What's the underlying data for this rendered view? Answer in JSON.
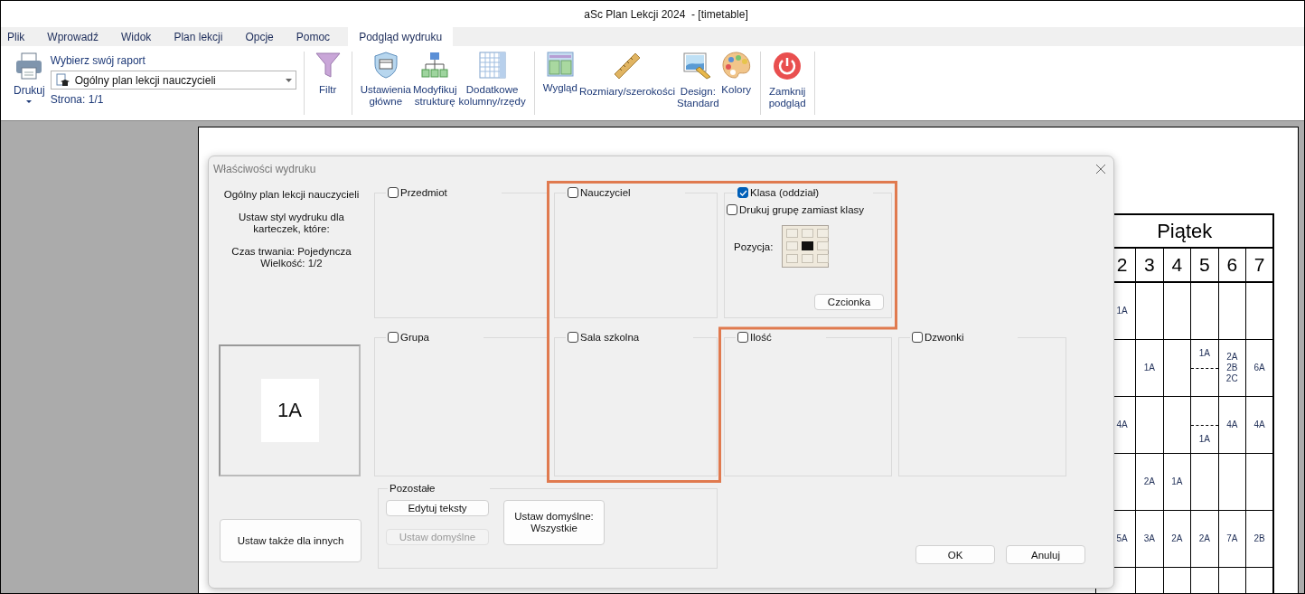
{
  "window": {
    "title": "aSc Plan Lekcji 2024  - [timetable]"
  },
  "menu_tabs": [
    {
      "label": "Plik",
      "selected": false
    },
    {
      "label": "Wprowadź",
      "selected": false
    },
    {
      "label": "Widok",
      "selected": false
    },
    {
      "label": "Plan lekcji",
      "selected": false
    },
    {
      "label": "Opcje",
      "selected": false
    },
    {
      "label": "Pomoc",
      "selected": false
    },
    {
      "label": "Podgląd wydruku",
      "selected": true
    }
  ],
  "ribbon": {
    "print_button": "Drukuj",
    "report_label": "Wybierz swój raport",
    "report_select": {
      "value": "Ogólny plan lekcji nauczycieli"
    },
    "page_info": "Strona: 1/1",
    "groups": [
      [
        {
          "kind": "filter",
          "label": "Filtr"
        }
      ],
      [
        {
          "kind": "settings",
          "label": "Ustawienia\ngłówne"
        },
        {
          "kind": "structure",
          "label": "Modyfikuj\nstrukturę"
        },
        {
          "kind": "columns",
          "label": "Dodatkowe\nkolumny/rzędy"
        }
      ],
      [
        {
          "kind": "layout",
          "label": "Wygląd"
        },
        {
          "kind": "sizes",
          "label": "Rozmiary/szerokości"
        },
        {
          "kind": "design",
          "label": "Design:\nStandard"
        },
        {
          "kind": "colors",
          "label": "Kolory"
        }
      ],
      [
        {
          "kind": "close",
          "label": "Zamknij\npodgląd"
        }
      ]
    ]
  },
  "timetable": {
    "day": "Piątek",
    "periods": [
      "2",
      "3",
      "4",
      "5",
      "6",
      "7"
    ],
    "rows": [
      [
        {
          "kind": "plain",
          "lines": [
            "1A"
          ]
        },
        {
          "kind": "empty"
        },
        {
          "kind": "empty"
        },
        {
          "kind": "empty"
        },
        {
          "kind": "empty"
        },
        {
          "kind": "empty"
        }
      ],
      [
        {
          "kind": "empty"
        },
        {
          "kind": "plain",
          "lines": [
            "1A"
          ]
        },
        {
          "kind": "empty"
        },
        {
          "kind": "split",
          "upper": "1A"
        },
        {
          "kind": "plain",
          "lines": [
            "2A",
            "2B",
            "2C"
          ]
        },
        {
          "kind": "plain",
          "lines": [
            "6A"
          ]
        }
      ],
      [
        {
          "kind": "plain",
          "lines": [
            "4A"
          ]
        },
        {
          "kind": "empty"
        },
        {
          "kind": "empty"
        },
        {
          "kind": "split",
          "lower": "1A"
        },
        {
          "kind": "plain",
          "lines": [
            "4A"
          ]
        },
        {
          "kind": "plain",
          "lines": [
            "4A"
          ]
        }
      ],
      [
        {
          "kind": "empty"
        },
        {
          "kind": "plain",
          "lines": [
            "2A"
          ]
        },
        {
          "kind": "plain",
          "lines": [
            "1A"
          ]
        },
        {
          "kind": "empty"
        },
        {
          "kind": "empty"
        },
        {
          "kind": "empty"
        }
      ],
      [
        {
          "kind": "plain",
          "lines": [
            "5A"
          ]
        },
        {
          "kind": "plain",
          "lines": [
            "3A"
          ]
        },
        {
          "kind": "plain",
          "lines": [
            "2A"
          ]
        },
        {
          "kind": "plain",
          "lines": [
            "2A"
          ]
        },
        {
          "kind": "plain",
          "lines": [
            "7A"
          ]
        },
        {
          "kind": "plain",
          "lines": [
            "2B"
          ]
        }
      ],
      [
        {
          "kind": "empty"
        },
        {
          "kind": "empty"
        },
        {
          "kind": "empty"
        },
        {
          "kind": "empty"
        },
        {
          "kind": "empty"
        },
        {
          "kind": "empty"
        }
      ]
    ]
  },
  "dialog": {
    "title": "Właściwości wydruku",
    "info": [
      "Ogólny plan lekcji nauczycieli",
      "Ustaw styl wydruku dla\nkarteczek, które:",
      "Czas trwania: Pojedyncza\nWielkość: 1/2"
    ],
    "preview_label": "1A",
    "apply_others_button": "Ustaw także dla innych",
    "group_rows": [
      [
        {
          "kind": "plain",
          "label": "Przedmiot",
          "checked": false
        },
        {
          "kind": "plain",
          "label": "Nauczyciel",
          "checked": false
        },
        {
          "kind": "detailed",
          "label": "Klasa (oddział)",
          "checked": true,
          "option": {
            "label": "Drukuj grupę zamiast klasy",
            "checked": false
          },
          "position": {
            "label": "Pozycja:",
            "cells": [
              {
                "selected": false
              },
              {
                "selected": false
              },
              {
                "selected": false
              },
              {
                "selected": false
              },
              {
                "selected": true
              },
              {
                "selected": false
              },
              {
                "selected": false
              },
              {
                "selected": false
              },
              {
                "selected": false
              }
            ]
          },
          "font_button": "Czcionka"
        }
      ],
      [
        {
          "kind": "plain",
          "label": "Grupa",
          "checked": false
        },
        {
          "kind": "plain",
          "label": "Sala szkolna",
          "checked": false
        },
        {
          "kind": "plain",
          "label": "Ilość",
          "checked": false
        },
        {
          "kind": "plain",
          "label": "Dzwonki",
          "checked": false
        }
      ]
    ],
    "other": {
      "title": "Pozostałe",
      "buttons": [
        {
          "label": "Edytuj teksty",
          "disabled": false
        },
        {
          "label": "Ustaw domyślne",
          "disabled": true
        }
      ],
      "default_all_button": "Ustaw domyślne:\nWszystkie"
    },
    "ok_button": "OK",
    "cancel_button": "Anuluj"
  }
}
